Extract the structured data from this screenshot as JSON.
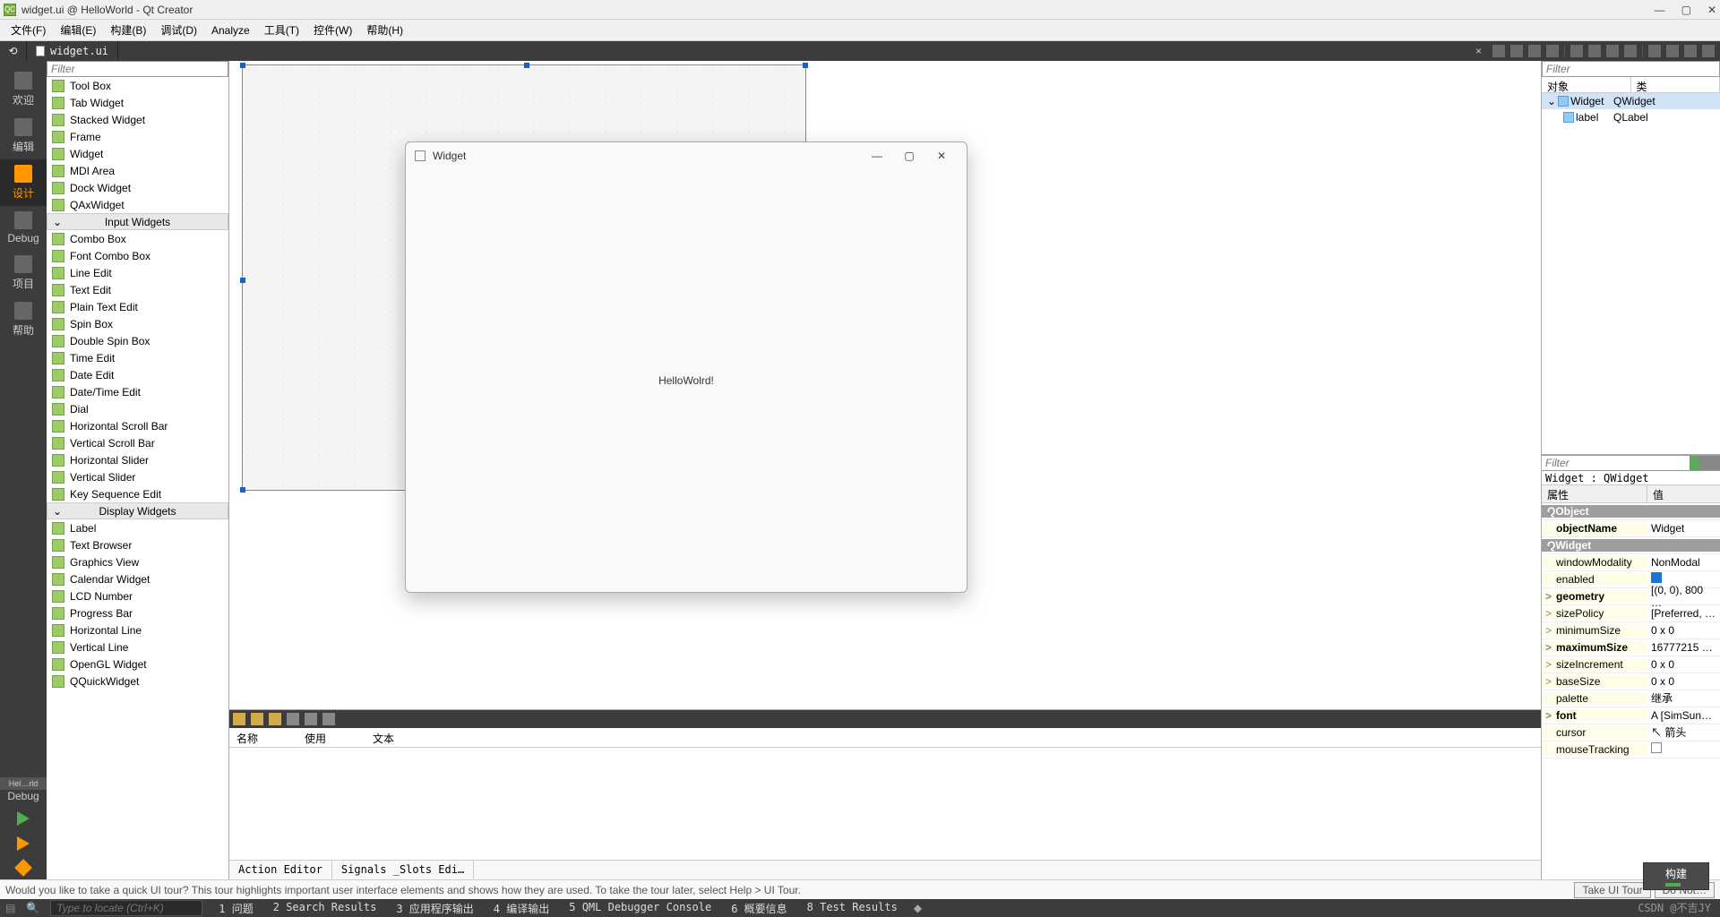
{
  "title": "widget.ui @ HelloWorld - Qt Creator",
  "menu": [
    "文件(F)",
    "编辑(E)",
    "构建(B)",
    "调试(D)",
    "Analyze",
    "工具(T)",
    "控件(W)",
    "帮助(H)"
  ],
  "tab": {
    "file": "widget.ui"
  },
  "leftbar": [
    {
      "label": "欢迎",
      "active": false
    },
    {
      "label": "编辑",
      "active": false
    },
    {
      "label": "设计",
      "active": true
    },
    {
      "label": "Debug",
      "active": false
    },
    {
      "label": "项目",
      "active": false
    },
    {
      "label": "帮助",
      "active": false
    }
  ],
  "leftbar_project": {
    "name": "Hel…rld",
    "mode": "Debug"
  },
  "widgetbox": {
    "filter_ph": "Filter",
    "groups": [
      {
        "cat": null,
        "items": [
          "Tool Box",
          "Tab Widget",
          "Stacked Widget",
          "Frame",
          "Widget",
          "MDI Area",
          "Dock Widget",
          "QAxWidget"
        ]
      },
      {
        "cat": "Input Widgets",
        "items": [
          "Combo Box",
          "Font Combo Box",
          "Line Edit",
          "Text Edit",
          "Plain Text Edit",
          "Spin Box",
          "Double Spin Box",
          "Time Edit",
          "Date Edit",
          "Date/Time Edit",
          "Dial",
          "Horizontal Scroll Bar",
          "Vertical Scroll Bar",
          "Horizontal Slider",
          "Vertical Slider",
          "Key Sequence Edit"
        ]
      },
      {
        "cat": "Display Widgets",
        "items": [
          "Label",
          "Text Browser",
          "Graphics View",
          "Calendar Widget",
          "LCD Number",
          "Progress Bar",
          "Horizontal Line",
          "Vertical Line",
          "OpenGL Widget",
          "QQuickWidget"
        ]
      }
    ]
  },
  "action_editor": {
    "columns": [
      "名称",
      "使用",
      "文本"
    ],
    "tabs": [
      "Action Editor",
      "Signals _Slots Edi…"
    ]
  },
  "object_tree": {
    "filter_ph": "Filter",
    "columns": [
      "对象",
      "类"
    ],
    "rows": [
      {
        "name": "Widget",
        "cls": "QWidget",
        "depth": 0,
        "sel": true,
        "exp": "⌄"
      },
      {
        "name": "label",
        "cls": "QLabel",
        "depth": 1,
        "sel": false,
        "exp": ""
      }
    ]
  },
  "property_editor": {
    "filter_ph": "Filter",
    "context": "Widget : QWidget",
    "columns": [
      "属性",
      "值"
    ],
    "rows": [
      {
        "type": "cat",
        "name": "QObject"
      },
      {
        "type": "p",
        "name": "objectName",
        "val": "Widget",
        "bold": true
      },
      {
        "type": "cat",
        "name": "QWidget"
      },
      {
        "type": "p",
        "name": "windowModality",
        "val": "NonModal"
      },
      {
        "type": "p",
        "name": "enabled",
        "val": "__check__"
      },
      {
        "type": "p",
        "name": "geometry",
        "val": "[(0, 0), 800 …",
        "bold": true,
        "exp": ">"
      },
      {
        "type": "p",
        "name": "sizePolicy",
        "val": "[Preferred, …",
        "exp": ">"
      },
      {
        "type": "p",
        "name": "minimumSize",
        "val": "0 x 0",
        "exp": ">"
      },
      {
        "type": "p",
        "name": "maximumSize",
        "val": "16777215 …",
        "bold": true,
        "exp": ">"
      },
      {
        "type": "p",
        "name": "sizeIncrement",
        "val": "0 x 0",
        "exp": ">"
      },
      {
        "type": "p",
        "name": "baseSize",
        "val": "0 x 0",
        "exp": ">"
      },
      {
        "type": "p",
        "name": "palette",
        "val": "继承"
      },
      {
        "type": "p",
        "name": "font",
        "val": "A [SimSun…",
        "bold": true,
        "exp": ">"
      },
      {
        "type": "p",
        "name": "cursor",
        "val": "↖ 箭头"
      },
      {
        "type": "p",
        "name": "mouseTracking",
        "val": "__uncheck__"
      }
    ]
  },
  "popup": {
    "title": "Widget",
    "content": "HelloWolrd!"
  },
  "tour": {
    "msg": "Would you like to take a quick UI tour? This tour highlights important user interface elements and shows how they are used. To take the tour later, select Help > UI Tour.",
    "btn_take": "Take UI Tour",
    "btn_no": "Do Not…"
  },
  "build_badge": "构建",
  "status": {
    "search_ph": "Type to locate (Ctrl+K)",
    "items": [
      "1 问题",
      "2 Search Results",
      "3 应用程序输出",
      "4 编译输出",
      "5 QML Debugger Console",
      "6 概要信息",
      "8 Test Results"
    ]
  },
  "watermark": "CSDN @不吉JY"
}
